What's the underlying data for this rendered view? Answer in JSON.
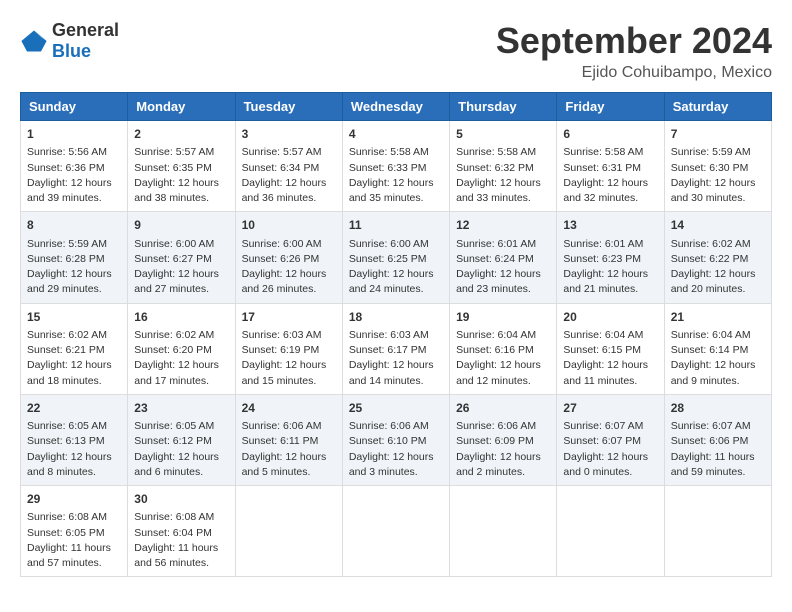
{
  "logo": {
    "text_general": "General",
    "text_blue": "Blue"
  },
  "title": "September 2024",
  "subtitle": "Ejido Cohuibampo, Mexico",
  "days_of_week": [
    "Sunday",
    "Monday",
    "Tuesday",
    "Wednesday",
    "Thursday",
    "Friday",
    "Saturday"
  ],
  "weeks": [
    [
      {
        "day": "1",
        "sunrise": "Sunrise: 5:56 AM",
        "sunset": "Sunset: 6:36 PM",
        "daylight": "Daylight: 12 hours and 39 minutes."
      },
      {
        "day": "2",
        "sunrise": "Sunrise: 5:57 AM",
        "sunset": "Sunset: 6:35 PM",
        "daylight": "Daylight: 12 hours and 38 minutes."
      },
      {
        "day": "3",
        "sunrise": "Sunrise: 5:57 AM",
        "sunset": "Sunset: 6:34 PM",
        "daylight": "Daylight: 12 hours and 36 minutes."
      },
      {
        "day": "4",
        "sunrise": "Sunrise: 5:58 AM",
        "sunset": "Sunset: 6:33 PM",
        "daylight": "Daylight: 12 hours and 35 minutes."
      },
      {
        "day": "5",
        "sunrise": "Sunrise: 5:58 AM",
        "sunset": "Sunset: 6:32 PM",
        "daylight": "Daylight: 12 hours and 33 minutes."
      },
      {
        "day": "6",
        "sunrise": "Sunrise: 5:58 AM",
        "sunset": "Sunset: 6:31 PM",
        "daylight": "Daylight: 12 hours and 32 minutes."
      },
      {
        "day": "7",
        "sunrise": "Sunrise: 5:59 AM",
        "sunset": "Sunset: 6:30 PM",
        "daylight": "Daylight: 12 hours and 30 minutes."
      }
    ],
    [
      {
        "day": "8",
        "sunrise": "Sunrise: 5:59 AM",
        "sunset": "Sunset: 6:28 PM",
        "daylight": "Daylight: 12 hours and 29 minutes."
      },
      {
        "day": "9",
        "sunrise": "Sunrise: 6:00 AM",
        "sunset": "Sunset: 6:27 PM",
        "daylight": "Daylight: 12 hours and 27 minutes."
      },
      {
        "day": "10",
        "sunrise": "Sunrise: 6:00 AM",
        "sunset": "Sunset: 6:26 PM",
        "daylight": "Daylight: 12 hours and 26 minutes."
      },
      {
        "day": "11",
        "sunrise": "Sunrise: 6:00 AM",
        "sunset": "Sunset: 6:25 PM",
        "daylight": "Daylight: 12 hours and 24 minutes."
      },
      {
        "day": "12",
        "sunrise": "Sunrise: 6:01 AM",
        "sunset": "Sunset: 6:24 PM",
        "daylight": "Daylight: 12 hours and 23 minutes."
      },
      {
        "day": "13",
        "sunrise": "Sunrise: 6:01 AM",
        "sunset": "Sunset: 6:23 PM",
        "daylight": "Daylight: 12 hours and 21 minutes."
      },
      {
        "day": "14",
        "sunrise": "Sunrise: 6:02 AM",
        "sunset": "Sunset: 6:22 PM",
        "daylight": "Daylight: 12 hours and 20 minutes."
      }
    ],
    [
      {
        "day": "15",
        "sunrise": "Sunrise: 6:02 AM",
        "sunset": "Sunset: 6:21 PM",
        "daylight": "Daylight: 12 hours and 18 minutes."
      },
      {
        "day": "16",
        "sunrise": "Sunrise: 6:02 AM",
        "sunset": "Sunset: 6:20 PM",
        "daylight": "Daylight: 12 hours and 17 minutes."
      },
      {
        "day": "17",
        "sunrise": "Sunrise: 6:03 AM",
        "sunset": "Sunset: 6:19 PM",
        "daylight": "Daylight: 12 hours and 15 minutes."
      },
      {
        "day": "18",
        "sunrise": "Sunrise: 6:03 AM",
        "sunset": "Sunset: 6:17 PM",
        "daylight": "Daylight: 12 hours and 14 minutes."
      },
      {
        "day": "19",
        "sunrise": "Sunrise: 6:04 AM",
        "sunset": "Sunset: 6:16 PM",
        "daylight": "Daylight: 12 hours and 12 minutes."
      },
      {
        "day": "20",
        "sunrise": "Sunrise: 6:04 AM",
        "sunset": "Sunset: 6:15 PM",
        "daylight": "Daylight: 12 hours and 11 minutes."
      },
      {
        "day": "21",
        "sunrise": "Sunrise: 6:04 AM",
        "sunset": "Sunset: 6:14 PM",
        "daylight": "Daylight: 12 hours and 9 minutes."
      }
    ],
    [
      {
        "day": "22",
        "sunrise": "Sunrise: 6:05 AM",
        "sunset": "Sunset: 6:13 PM",
        "daylight": "Daylight: 12 hours and 8 minutes."
      },
      {
        "day": "23",
        "sunrise": "Sunrise: 6:05 AM",
        "sunset": "Sunset: 6:12 PM",
        "daylight": "Daylight: 12 hours and 6 minutes."
      },
      {
        "day": "24",
        "sunrise": "Sunrise: 6:06 AM",
        "sunset": "Sunset: 6:11 PM",
        "daylight": "Daylight: 12 hours and 5 minutes."
      },
      {
        "day": "25",
        "sunrise": "Sunrise: 6:06 AM",
        "sunset": "Sunset: 6:10 PM",
        "daylight": "Daylight: 12 hours and 3 minutes."
      },
      {
        "day": "26",
        "sunrise": "Sunrise: 6:06 AM",
        "sunset": "Sunset: 6:09 PM",
        "daylight": "Daylight: 12 hours and 2 minutes."
      },
      {
        "day": "27",
        "sunrise": "Sunrise: 6:07 AM",
        "sunset": "Sunset: 6:07 PM",
        "daylight": "Daylight: 12 hours and 0 minutes."
      },
      {
        "day": "28",
        "sunrise": "Sunrise: 6:07 AM",
        "sunset": "Sunset: 6:06 PM",
        "daylight": "Daylight: 11 hours and 59 minutes."
      }
    ],
    [
      {
        "day": "29",
        "sunrise": "Sunrise: 6:08 AM",
        "sunset": "Sunset: 6:05 PM",
        "daylight": "Daylight: 11 hours and 57 minutes."
      },
      {
        "day": "30",
        "sunrise": "Sunrise: 6:08 AM",
        "sunset": "Sunset: 6:04 PM",
        "daylight": "Daylight: 11 hours and 56 minutes."
      },
      null,
      null,
      null,
      null,
      null
    ]
  ]
}
